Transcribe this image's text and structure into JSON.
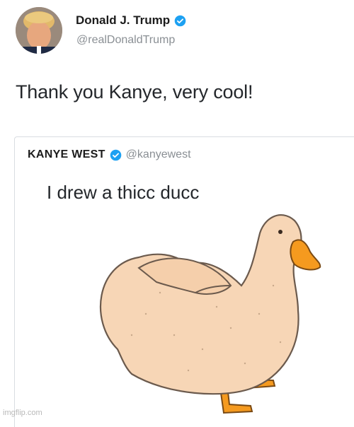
{
  "tweet": {
    "author_name": "Donald J. Trump",
    "author_handle": "@realDonaldTrump",
    "text": "Thank you Kanye, very cool!"
  },
  "quoted_tweet": {
    "author_name": "KANYE WEST",
    "author_handle": "@kanyewest",
    "text": "I drew a thicc ducc"
  },
  "icons": {
    "verified": "verified-badge-icon",
    "avatar": "user-avatar",
    "drawing": "duck-drawing"
  },
  "colors": {
    "verified_blue": "#1da1f2",
    "duck_body": "#f7d6b6",
    "duck_beak": "#f59a1f"
  },
  "watermark": "imgflip.com"
}
